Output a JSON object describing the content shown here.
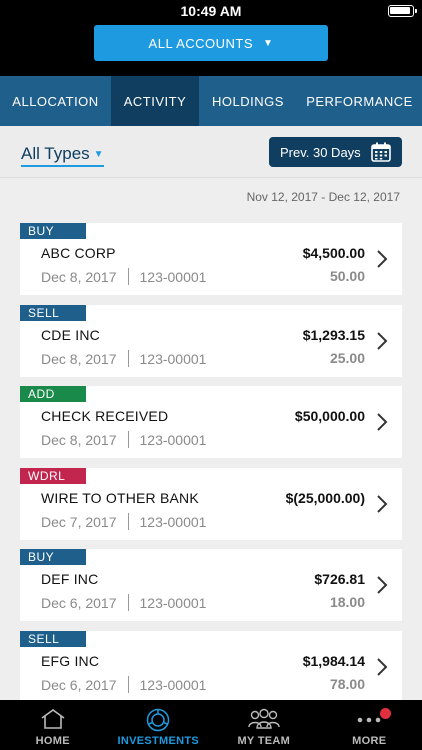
{
  "status_bar": {
    "time": "10:49 AM"
  },
  "header": {
    "accounts_label": "ALL ACCOUNTS"
  },
  "tabs": [
    {
      "label": "ALLOCATION",
      "active": false
    },
    {
      "label": "ACTIVITY",
      "active": true
    },
    {
      "label": "HOLDINGS",
      "active": false
    },
    {
      "label": "PERFORMANCE",
      "active": false
    }
  ],
  "filter": {
    "type_label": "All Types",
    "period_label": "Prev. 30 Days"
  },
  "date_range": "Nov 12, 2017 - Dec 12, 2017",
  "badge_colors": {
    "BUY": "#1f5f8c",
    "SELL": "#1f5f8c",
    "ADD": "#1a8a4a",
    "WDRL": "#c2264f"
  },
  "transactions": [
    {
      "type": "BUY",
      "name": "ABC CORP",
      "date": "Dec 8, 2017",
      "account": "123-00001",
      "amount": "$4,500.00",
      "quantity": "50.00"
    },
    {
      "type": "SELL",
      "name": "CDE INC",
      "date": "Dec 8, 2017",
      "account": "123-00001",
      "amount": "$1,293.15",
      "quantity": "25.00"
    },
    {
      "type": "ADD",
      "name": "CHECK RECEIVED",
      "date": "Dec 8, 2017",
      "account": "123-00001",
      "amount": "$50,000.00",
      "quantity": ""
    },
    {
      "type": "WDRL",
      "name": "WIRE TO OTHER BANK",
      "date": "Dec 7, 2017",
      "account": "123-00001",
      "amount": "$(25,000.00)",
      "quantity": ""
    },
    {
      "type": "BUY",
      "name": "DEF INC",
      "date": "Dec 6, 2017",
      "account": "123-00001",
      "amount": "$726.81",
      "quantity": "18.00"
    },
    {
      "type": "SELL",
      "name": "EFG INC",
      "date": "Dec 6, 2017",
      "account": "123-00001",
      "amount": "$1,984.14",
      "quantity": "78.00"
    }
  ],
  "bottom_nav": [
    {
      "label": "HOME",
      "icon": "home-icon",
      "active": false
    },
    {
      "label": "INVESTMENTS",
      "icon": "investments-icon",
      "active": true
    },
    {
      "label": "MY TEAM",
      "icon": "team-icon",
      "active": false
    },
    {
      "label": "MORE",
      "icon": "more-icon",
      "active": false
    }
  ]
}
